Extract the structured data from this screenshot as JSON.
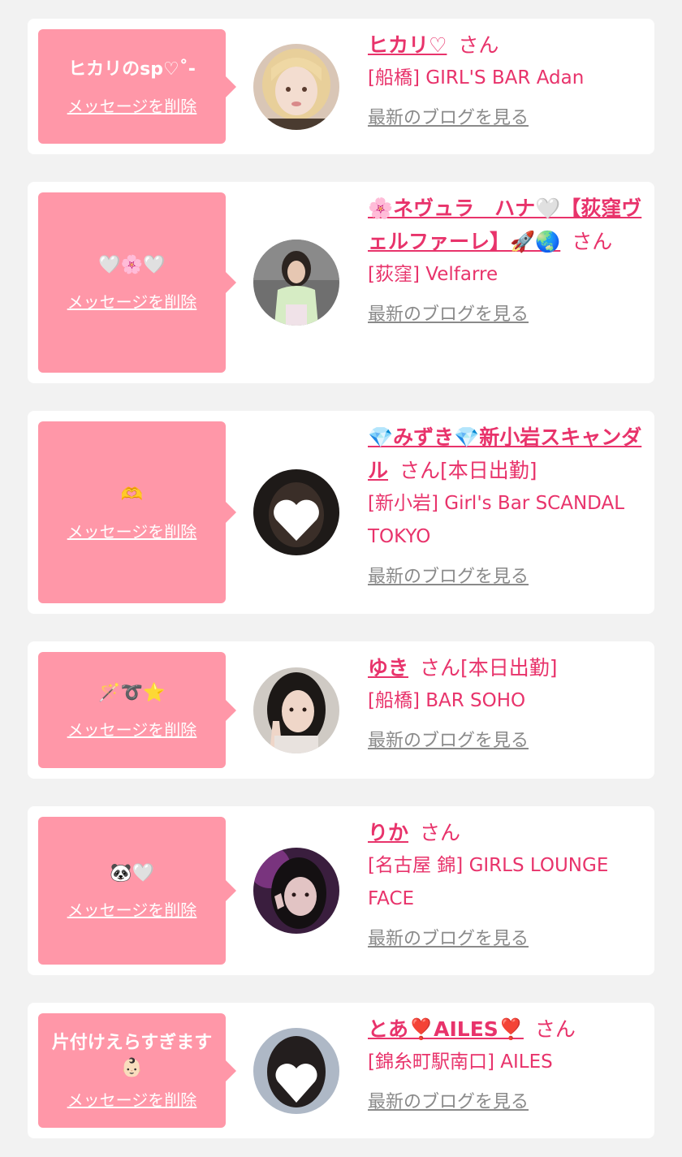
{
  "labels": {
    "delete_message": "メッセージを削除",
    "latest_blog": "最新のブログを見る",
    "honorific": "さん"
  },
  "colors": {
    "page_bg": "#f2f2f2",
    "bubble_bg": "#ff97a8",
    "accent_pink": "#e8336b",
    "link_gray": "#8a8a8a"
  },
  "items": [
    {
      "message": "ヒカリのsp♡˚-",
      "name": "ヒカリ♡",
      "status": "",
      "shop": "[船橋] GIRL'S BAR Adan",
      "avatar_icon": "girl-blonde-avatar"
    },
    {
      "message": "🤍🌸🤍",
      "name": "🌸ネヴュラ　ハナ🤍【荻窪ヴェルファーレ】🚀🌏",
      "status": "",
      "shop": "[荻窪] Velfarre",
      "avatar_icon": "girl-dark-hair-avatar"
    },
    {
      "message": "🫶",
      "name": "💎みずき💎新小岩スキャンダル",
      "status": "[本日出勤]",
      "shop": "[新小岩] Girl's Bar SCANDAL TOKYO",
      "avatar_icon": "heart-face-avatar"
    },
    {
      "message": "🪄➰⭐",
      "name": "ゆき",
      "status": "[本日出勤]",
      "shop": "[船橋] BAR SOHO",
      "avatar_icon": "girl-peace-sign-avatar"
    },
    {
      "message": "🐼🤍",
      "name": "りか",
      "status": "",
      "shop": "[名古屋 錦] GIRLS LOUNGE FACE",
      "avatar_icon": "girl-purple-light-avatar"
    },
    {
      "message": "片付けえらすぎます👶🏻",
      "name": "とあ❣️AILES❣️",
      "status": "",
      "shop": "[錦糸町駅南口] AILES",
      "avatar_icon": "heart-face-avatar"
    }
  ]
}
